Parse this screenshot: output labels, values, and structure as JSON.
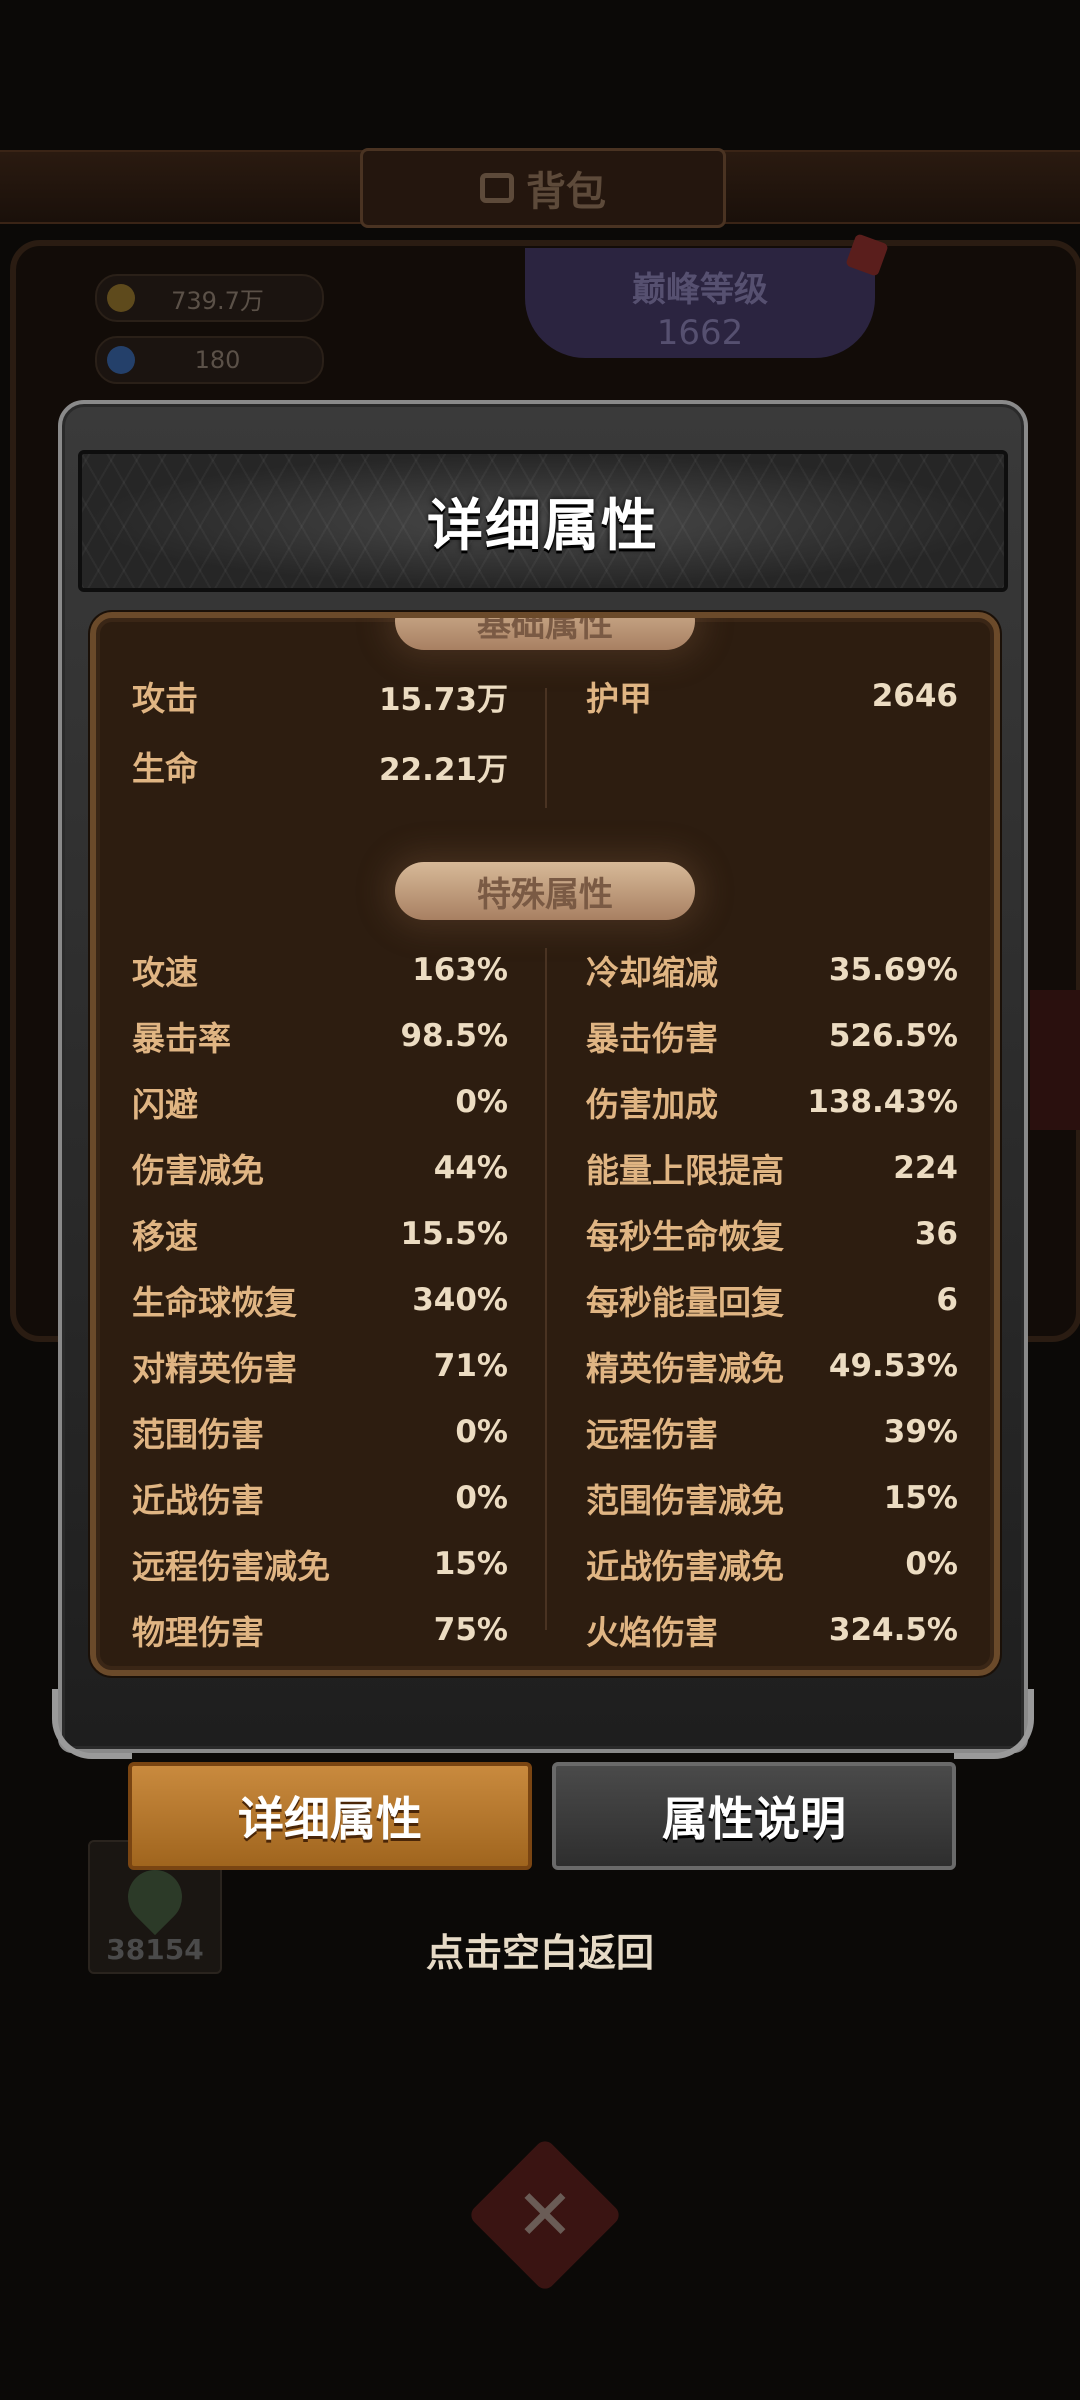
{
  "background": {
    "tab_label": "背包",
    "gold": "739.7万",
    "gems": "180",
    "peak_level_title": "巅峰等级",
    "peak_level_value": "1662",
    "item_count": "38154"
  },
  "modal": {
    "title": "详细属性",
    "base_section": "基础属性",
    "special_section": "特殊属性",
    "base_left": [
      {
        "name": "攻击",
        "value": "15.73万"
      },
      {
        "name": "生命",
        "value": "22.21万"
      }
    ],
    "base_right": [
      {
        "name": "护甲",
        "value": "2646"
      }
    ],
    "special_left": [
      {
        "name": "攻速",
        "value": "163%"
      },
      {
        "name": "暴击率",
        "value": "98.5%"
      },
      {
        "name": "闪避",
        "value": "0%"
      },
      {
        "name": "伤害减免",
        "value": "44%"
      },
      {
        "name": "移速",
        "value": "15.5%"
      },
      {
        "name": "生命球恢复",
        "value": "340%"
      },
      {
        "name": "对精英伤害",
        "value": "71%"
      },
      {
        "name": "范围伤害",
        "value": "0%"
      },
      {
        "name": "近战伤害",
        "value": "0%"
      },
      {
        "name": "远程伤害减免",
        "value": "15%"
      },
      {
        "name": "物理伤害",
        "value": "75%"
      }
    ],
    "special_right": [
      {
        "name": "冷却缩减",
        "value": "35.69%"
      },
      {
        "name": "暴击伤害",
        "value": "526.5%"
      },
      {
        "name": "伤害加成",
        "value": "138.43%"
      },
      {
        "name": "能量上限提高",
        "value": "224"
      },
      {
        "name": "每秒生命恢复",
        "value": "36"
      },
      {
        "name": "每秒能量回复",
        "value": "6"
      },
      {
        "name": "精英伤害减免",
        "value": "49.53%"
      },
      {
        "name": "远程伤害",
        "value": "39%"
      },
      {
        "name": "范围伤害减免",
        "value": "15%"
      },
      {
        "name": "近战伤害减免",
        "value": "0%"
      },
      {
        "name": "火焰伤害",
        "value": "324.5%"
      }
    ]
  },
  "buttons": {
    "detail": "详细属性",
    "explain": "属性说明"
  },
  "return_hint": "点击空白返回",
  "colors": {
    "accent_orange": "#c98a3e",
    "panel_brown": "#2d1d10",
    "attr_name": "#e0b583",
    "attr_value": "#ecdcc2"
  }
}
